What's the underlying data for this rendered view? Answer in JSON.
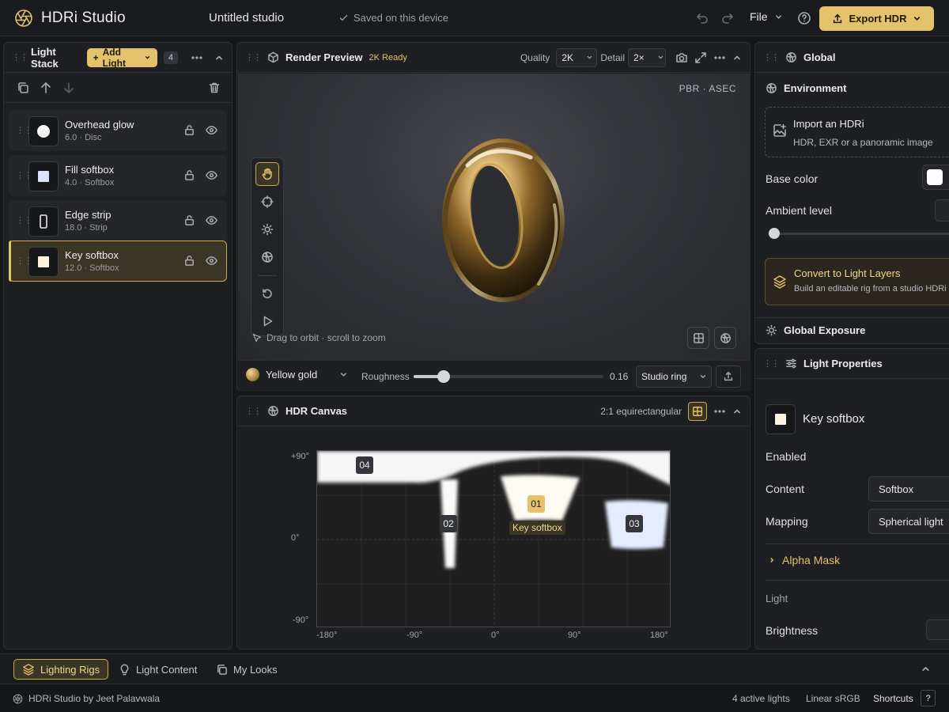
{
  "app": {
    "name": "HDRi Studio",
    "doc_title": "Untitled studio",
    "saved_status": "Saved on this device",
    "file_menu": "File",
    "export_label": "Export HDR"
  },
  "colors": {
    "accent": "#e3c26b",
    "panel": "#1e1f22",
    "background": "#161719",
    "selected_row": "#3a3525"
  },
  "light_stack": {
    "title": "Light Stack",
    "add_label": "Add Light",
    "count": "4",
    "lights": [
      {
        "name": "Overhead glow",
        "meta": "6.0 · Disc",
        "shape": "disc",
        "selected": false
      },
      {
        "name": "Fill softbox",
        "meta": "4.0 · Softbox",
        "shape": "softbox-blue",
        "selected": false
      },
      {
        "name": "Edge strip",
        "meta": "18.0 · Strip",
        "shape": "strip",
        "selected": false
      },
      {
        "name": "Key softbox",
        "meta": "12.0 · Softbox",
        "shape": "softbox-warm",
        "selected": true
      }
    ]
  },
  "render_preview": {
    "title": "Render Preview",
    "status": "2K Ready",
    "quality_label": "Quality",
    "quality_value": "2K",
    "detail_label": "Detail",
    "detail_value": "2×",
    "badges": "PBR · ASEC",
    "hint": "Drag to orbit · scroll to zoom",
    "material": "Yellow gold",
    "roughness_label": "Roughness",
    "roughness_value": "0.16",
    "roughness": 0.16,
    "preset": "Studio ring"
  },
  "hdr_canvas": {
    "title": "HDR Canvas",
    "projection": "2:1 equirectangular",
    "y_ticks": [
      "+90°",
      "0°",
      "-90°"
    ],
    "x_ticks": [
      "-180°",
      "-90°",
      "0°",
      "90°",
      "180°"
    ],
    "markers": [
      {
        "id": "01",
        "label": "Key softbox"
      },
      {
        "id": "02"
      },
      {
        "id": "03"
      },
      {
        "id": "04"
      }
    ]
  },
  "global": {
    "title": "Global",
    "environment_title": "Environment",
    "import_title": "Import an HDRi",
    "import_sub": "HDR, EXR or a panoramic image",
    "base_color_label": "Base color",
    "ambient_label": "Ambient level",
    "convert_title": "Convert to Light Layers",
    "convert_sub": "Build an editable rig from a studio HDRi",
    "exposure_title": "Global Exposure"
  },
  "light_properties": {
    "title": "Light Properties",
    "selected_name": "Key softbox",
    "enabled_label": "Enabled",
    "content_label": "Content",
    "content_value": "Softbox",
    "mapping_label": "Mapping",
    "mapping_value": "Spherical light",
    "alpha_mask": "Alpha Mask",
    "light_section": "Light",
    "brightness_label": "Brightness"
  },
  "tabs": [
    {
      "label": "Lighting Rigs",
      "active": true
    },
    {
      "label": "Light Content",
      "active": false
    },
    {
      "label": "My Looks",
      "active": false
    }
  ],
  "status": {
    "credit": "HDRi Studio by Jeet Palavwala",
    "active_lights": "4 active lights",
    "color_space": "Linear sRGB",
    "shortcuts": "Shortcuts",
    "shortcut_key": "?"
  }
}
